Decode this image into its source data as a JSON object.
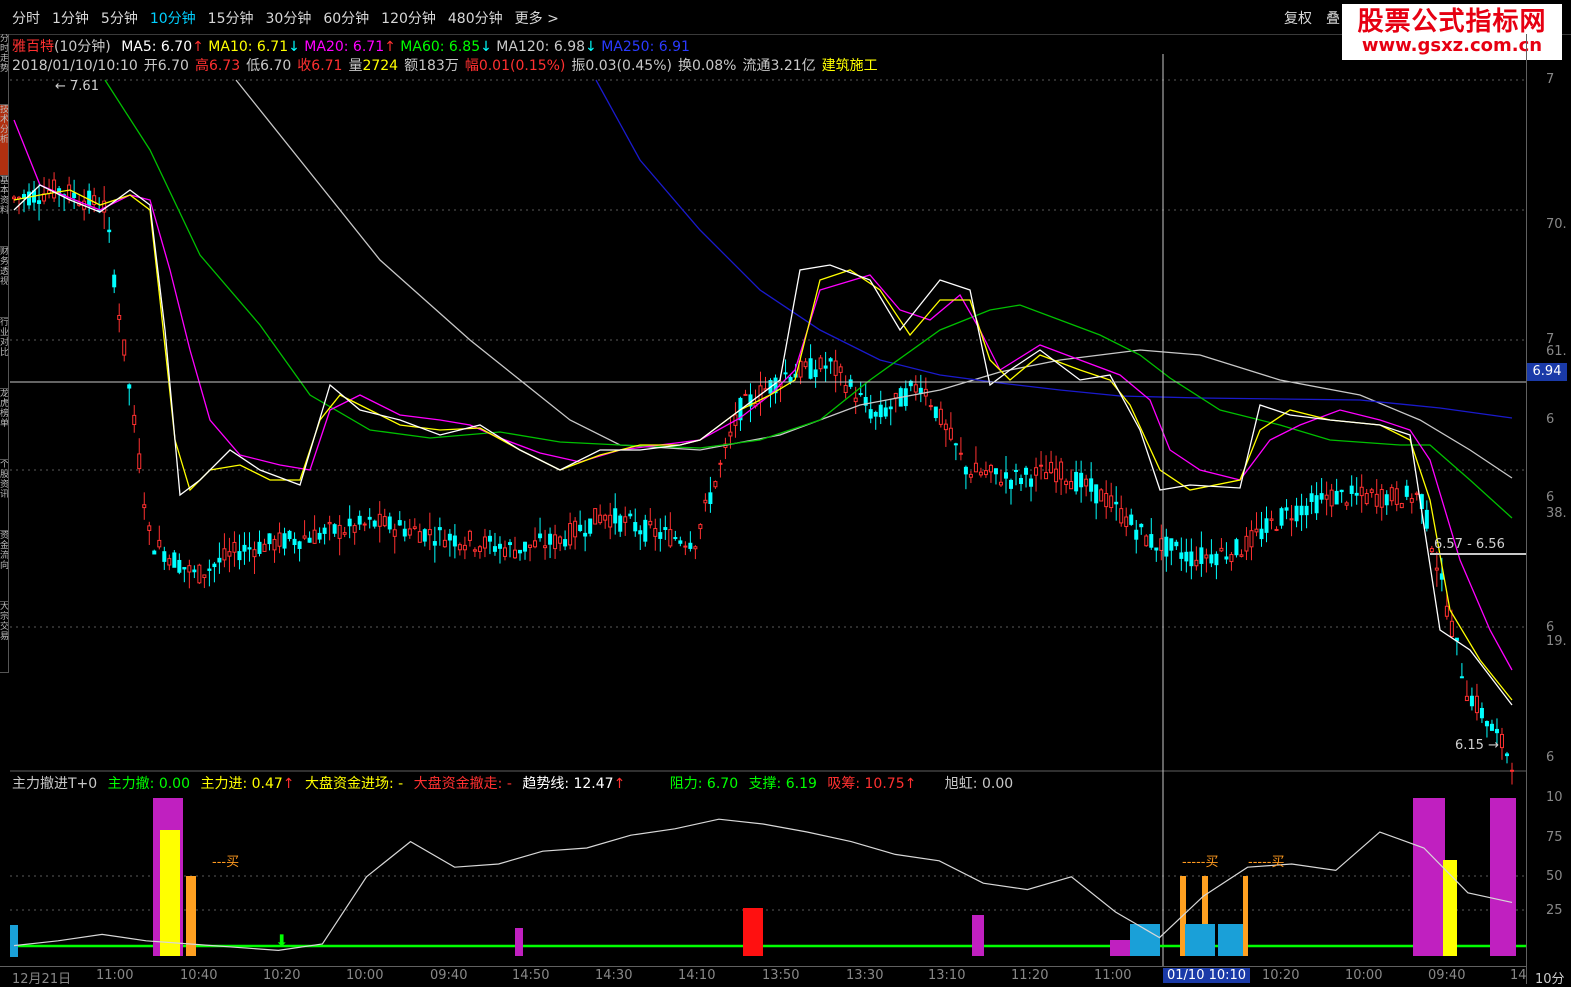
{
  "toolbar": {
    "tabs": [
      "分时",
      "1分钟",
      "5分钟",
      "10分钟",
      "15分钟",
      "30分钟",
      "60分钟",
      "120分钟",
      "480分钟",
      "更多"
    ],
    "more_arrow": ">",
    "active_tab": "10分钟",
    "right_tabs": [
      "复权",
      "叠"
    ]
  },
  "watermark": {
    "title": "股票公式指标网",
    "url": "www.gsxz.com.cn"
  },
  "side_tabs": [
    "分时走势",
    "技术分析",
    "基本资料",
    "财务透视",
    "行业对比",
    "龙虎榜单",
    "个股资讯",
    "资金流向",
    "大宗交易"
  ],
  "info": {
    "stock_name": "雅百特",
    "period": "(10分钟)",
    "ma5": "MA5: 6.70",
    "ma10": "MA10: 6.71",
    "ma20": "MA20: 6.71",
    "ma60": "MA60: 6.85",
    "ma120": "MA120: 6.98",
    "ma250": "MA250: 6.91",
    "datetime": "2018/01/10/10:10",
    "open_label": "开",
    "open": "6.70",
    "high_label": "高",
    "high": "6.73",
    "low_label": "低",
    "low": "6.70",
    "close_label": "收",
    "close": "6.71",
    "vol_label": "量",
    "vol": "2724",
    "amt_label": "额",
    "amt": "183万",
    "chg_label": "幅",
    "chg": "0.01(0.15%)",
    "amp_label": "振",
    "amp": "0.03(0.45%)",
    "turn_label": "换",
    "turn": "0.08%",
    "float_label": "流通",
    "float": "3.21亿",
    "industry": "建筑施工"
  },
  "indicator": {
    "name": "主力撤进T+0",
    "zlc": "主力撤: 0.00",
    "zlj": "主力进: 0.47",
    "dpjc": "大盘资金进场: -",
    "dpcz": "大盘资金撤走: -",
    "qsx": "趋势线: 12.47",
    "zl": "阻力: 6.70",
    "zc": "支撑: 6.19",
    "xc": "吸筹: 10.75",
    "xh": "旭虹: 0.00",
    "buy_label": "买"
  },
  "annotations": {
    "high_mark": "7.61",
    "low_mark": "6.15",
    "price_range": "6.57 - 6.56"
  },
  "axis": {
    "price_ticks": [
      "7",
      "70.",
      "7",
      "61.",
      "6",
      "6",
      "38.",
      "6",
      "19.",
      "6"
    ],
    "current_price": "6.94",
    "indicator_ticks": [
      "10",
      "75",
      "50",
      "25"
    ],
    "x_labels": [
      "12月21日",
      "11:00",
      "10:40",
      "10:20",
      "10:00",
      "09:40",
      "14:50",
      "14:30",
      "14:10",
      "13:50",
      "13:30",
      "13:10",
      "11:20",
      "11:00",
      "01/10 10:10",
      "10:20",
      "10:00",
      "09:40",
      "14"
    ],
    "period_label": "10分"
  },
  "colors": {
    "ma5": "#ffffff",
    "ma10": "#ffff00",
    "ma20": "#ff00ff",
    "ma60": "#00ff00",
    "ma120": "#c8c8c8",
    "ma250": "#1a1aff",
    "up": "#ff3030",
    "down": "#00ffff"
  },
  "chart_data": {
    "type": "line",
    "title": "雅百特(10分钟)",
    "series": [
      {
        "name": "MA5",
        "values": [
          7.38,
          7.4,
          7.36,
          6.6,
          6.52,
          6.58,
          6.6,
          6.62,
          6.64,
          6.62,
          6.6,
          6.58,
          6.6,
          6.66,
          6.62,
          6.6,
          6.9,
          6.98,
          7.0,
          6.88,
          6.96,
          6.76,
          6.74,
          6.76,
          6.7,
          6.6,
          6.56,
          6.58,
          6.66,
          6.7,
          6.7,
          6.7,
          6.26,
          6.1
        ]
      },
      {
        "name": "MA60",
        "values": [
          7.5,
          7.4,
          7.2,
          7.05,
          6.9,
          6.75,
          6.72,
          6.72,
          6.7,
          6.64,
          6.63,
          6.62,
          6.61,
          6.61,
          6.62,
          6.63,
          6.7,
          6.78,
          6.84,
          6.87,
          6.88,
          6.84,
          6.8,
          6.75,
          6.72,
          6.7,
          6.66,
          6.64,
          6.64,
          6.64,
          6.66,
          6.64,
          6.56,
          6.42
        ]
      }
    ],
    "ylim": [
      6.1,
      7.65
    ],
    "indicator": {
      "type": "area",
      "ylim": [
        0,
        100
      ],
      "values": [
        9,
        12,
        16,
        12,
        10,
        8,
        6,
        10,
        52,
        74,
        58,
        60,
        68,
        70,
        78,
        82,
        88,
        85,
        80,
        74,
        66,
        62,
        48,
        44,
        52,
        30,
        14,
        40,
        58,
        60,
        56,
        80,
        70,
        42,
        36
      ]
    }
  }
}
